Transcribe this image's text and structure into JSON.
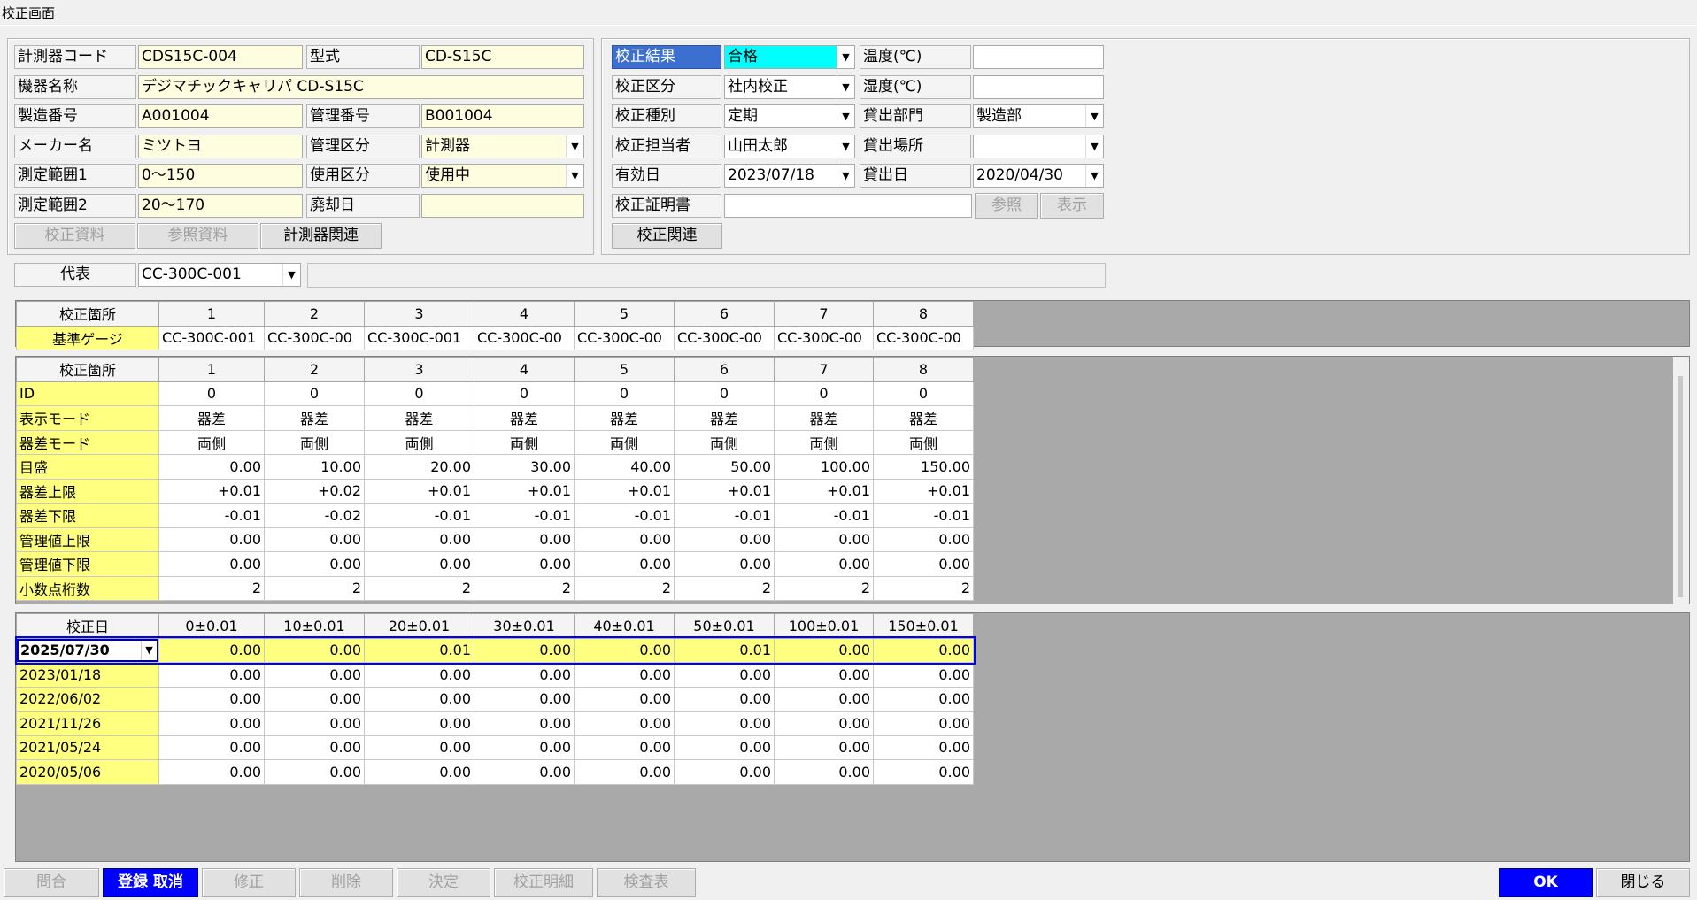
{
  "window": {
    "title": "校正画面"
  },
  "instrument": {
    "code_label": "計測器コード",
    "code": "CDS15C-004",
    "model_label": "型式",
    "model": "CD-S15C",
    "name_label": "機器名称",
    "name": "デジマチックキャリパ CD-S15C",
    "serial_label": "製造番号",
    "serial": "A001004",
    "mgmt_no_label": "管理番号",
    "mgmt_no": "B001004",
    "maker_label": "メーカー名",
    "maker": "ミツトヨ",
    "mgmt_class_label": "管理区分",
    "mgmt_class": "計測器",
    "range1_label": "測定範囲1",
    "range1": "0～150",
    "usage_label": "使用区分",
    "usage": "使用中",
    "range2_label": "測定範囲2",
    "range2": "20～170",
    "disposal_label": "廃却日",
    "disposal": "",
    "btn_calib_docs": "校正資料",
    "btn_ref_docs": "参照資料",
    "btn_related": "計測器関連"
  },
  "calibration": {
    "result_label": "校正結果",
    "result": "合格",
    "temp1_label": "温度(℃)",
    "temp1": "",
    "class_label": "校正区分",
    "class": "社内校正",
    "temp2_label": "湿度(℃)",
    "temp2": "",
    "type_label": "校正種別",
    "type": "定期",
    "lend_dept_label": "貸出部門",
    "lend_dept": "製造部",
    "person_label": "校正担当者",
    "person": "山田太郎",
    "lend_place_label": "貸出場所",
    "lend_place": "",
    "valid_label": "有効日",
    "valid": "2023/07/18",
    "lend_date_label": "貸出日",
    "lend_date": "2020/04/30",
    "cert_label": "校正証明書",
    "cert": "",
    "btn_browse": "参照",
    "btn_show": "表示",
    "btn_related": "校正関連"
  },
  "representative": {
    "label": "代表",
    "value": "CC-300C-001",
    "note": ""
  },
  "gauge_table": {
    "header_label": "校正箇所",
    "cols": [
      "1",
      "2",
      "3",
      "4",
      "5",
      "6",
      "7",
      "8"
    ],
    "row_label": "基準ゲージ",
    "values": [
      "CC-300C-001",
      "CC-300C-00",
      "CC-300C-001",
      "CC-300C-00",
      "CC-300C-00",
      "CC-300C-00",
      "CC-300C-00",
      "CC-300C-00"
    ]
  },
  "settings_table": {
    "header_label": "校正箇所",
    "cols": [
      "1",
      "2",
      "3",
      "4",
      "5",
      "6",
      "7",
      "8"
    ],
    "rows": [
      {
        "label": "ID",
        "values": [
          "0",
          "0",
          "0",
          "0",
          "0",
          "0",
          "0",
          "0"
        ],
        "align": "c"
      },
      {
        "label": "表示モード",
        "values": [
          "器差",
          "器差",
          "器差",
          "器差",
          "器差",
          "器差",
          "器差",
          "器差"
        ],
        "align": "c"
      },
      {
        "label": "器差モード",
        "values": [
          "両側",
          "両側",
          "両側",
          "両側",
          "両側",
          "両側",
          "両側",
          "両側"
        ],
        "align": "c"
      },
      {
        "label": "目盛",
        "values": [
          "0.00",
          "10.00",
          "20.00",
          "30.00",
          "40.00",
          "50.00",
          "100.00",
          "150.00"
        ],
        "align": "r"
      },
      {
        "label": "器差上限",
        "values": [
          "+0.01",
          "+0.02",
          "+0.01",
          "+0.01",
          "+0.01",
          "+0.01",
          "+0.01",
          "+0.01"
        ],
        "align": "r"
      },
      {
        "label": "器差下限",
        "values": [
          "-0.01",
          "-0.02",
          "-0.01",
          "-0.01",
          "-0.01",
          "-0.01",
          "-0.01",
          "-0.01"
        ],
        "align": "r"
      },
      {
        "label": "管理値上限",
        "values": [
          "0.00",
          "0.00",
          "0.00",
          "0.00",
          "0.00",
          "0.00",
          "0.00",
          "0.00"
        ],
        "align": "r"
      },
      {
        "label": "管理値下限",
        "values": [
          "0.00",
          "0.00",
          "0.00",
          "0.00",
          "0.00",
          "0.00",
          "0.00",
          "0.00"
        ],
        "align": "r"
      },
      {
        "label": "小数点桁数",
        "values": [
          "2",
          "2",
          "2",
          "2",
          "2",
          "2",
          "2",
          "2"
        ],
        "align": "r"
      }
    ]
  },
  "history_table": {
    "header_label": "校正日",
    "cols": [
      "0±0.01",
      "10±0.01",
      "20±0.01",
      "30±0.01",
      "40±0.01",
      "50±0.01",
      "100±0.01",
      "150±0.01"
    ],
    "rows": [
      {
        "date": "2025/07/30",
        "values": [
          "0.00",
          "0.00",
          "0.01",
          "0.00",
          "0.00",
          "0.01",
          "0.00",
          "0.00"
        ],
        "current": true
      },
      {
        "date": "2023/01/18",
        "values": [
          "0.00",
          "0.00",
          "0.00",
          "0.00",
          "0.00",
          "0.00",
          "0.00",
          "0.00"
        ]
      },
      {
        "date": "2022/06/02",
        "values": [
          "0.00",
          "0.00",
          "0.00",
          "0.00",
          "0.00",
          "0.00",
          "0.00",
          "0.00"
        ]
      },
      {
        "date": "2021/11/26",
        "values": [
          "0.00",
          "0.00",
          "0.00",
          "0.00",
          "0.00",
          "0.00",
          "0.00",
          "0.00"
        ]
      },
      {
        "date": "2021/05/24",
        "values": [
          "0.00",
          "0.00",
          "0.00",
          "0.00",
          "0.00",
          "0.00",
          "0.00",
          "0.00"
        ]
      },
      {
        "date": "2020/05/06",
        "values": [
          "0.00",
          "0.00",
          "0.00",
          "0.00",
          "0.00",
          "0.00",
          "0.00",
          "0.00"
        ]
      }
    ]
  },
  "footer": {
    "inquiry": "問合",
    "register_cancel": "登録 取消",
    "modify": "修正",
    "delete": "削除",
    "decide": "決定",
    "detail": "校正明細",
    "report": "検査表",
    "ok": "OK",
    "close": "閉じる"
  },
  "colors": {
    "field": "#fffde0",
    "row_header": "#ffff80",
    "selected": "#3c6fd0",
    "result": "#00ffff",
    "primary_button": "#0000ff"
  },
  "icons": {
    "dropdown": "chevron-down-icon"
  }
}
